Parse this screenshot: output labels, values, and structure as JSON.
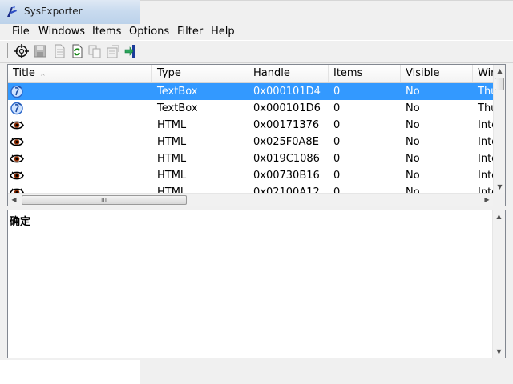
{
  "window": {
    "title": "SysExporter"
  },
  "menu": [
    "File",
    "Windows",
    "Items",
    "Options",
    "Filter",
    "Help"
  ],
  "toolbar": {
    "buttons": [
      "crosshair-icon",
      "save-icon",
      "document-icon",
      "refresh-icon",
      "copy-icon",
      "properties-icon",
      "exit-icon"
    ]
  },
  "listview": {
    "columns": [
      "Title",
      "Type",
      "Handle",
      "Items",
      "Visible",
      "Win"
    ],
    "sort_indicator": "^",
    "rows": [
      {
        "icon": "textbox-icon",
        "type": "TextBox",
        "handle": "0x000101D4",
        "items": "0",
        "visible": "No",
        "win": "Thu",
        "selected": true
      },
      {
        "icon": "textbox-icon",
        "type": "TextBox",
        "handle": "0x000101D6",
        "items": "0",
        "visible": "No",
        "win": "Thu",
        "selected": false
      },
      {
        "icon": "eye-icon",
        "type": "HTML",
        "handle": "0x00171376",
        "items": "0",
        "visible": "No",
        "win": "Inte",
        "selected": false
      },
      {
        "icon": "eye-icon",
        "type": "HTML",
        "handle": "0x025F0A8E",
        "items": "0",
        "visible": "No",
        "win": "Inte",
        "selected": false
      },
      {
        "icon": "eye-icon",
        "type": "HTML",
        "handle": "0x019C1086",
        "items": "0",
        "visible": "No",
        "win": "Inte",
        "selected": false
      },
      {
        "icon": "eye-icon",
        "type": "HTML",
        "handle": "0x00730B16",
        "items": "0",
        "visible": "No",
        "win": "Inte",
        "selected": false
      },
      {
        "icon": "eye-icon",
        "type": "HTML",
        "handle": "0x02100A12",
        "items": "0",
        "visible": "No",
        "win": "Inte",
        "selected": false
      }
    ],
    "hscroll_grip": "III"
  },
  "textpane": {
    "content": "确定"
  }
}
